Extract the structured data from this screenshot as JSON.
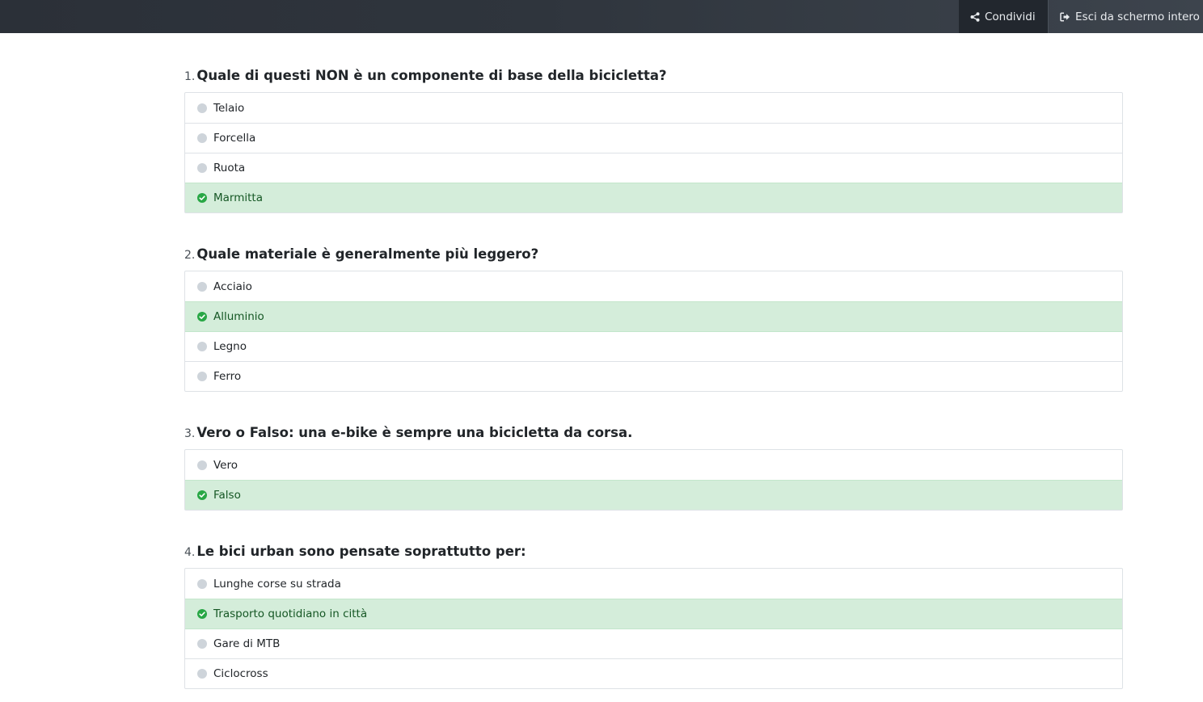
{
  "topbar": {
    "share_label": "Condividi",
    "share_icon": "share-icon",
    "exit_label": "Esci da schermo intero",
    "exit_icon": "sign-out-icon"
  },
  "colors": {
    "topbar": "#2f353d",
    "correct_bg": "#d4edda",
    "correct_text": "#155724",
    "check": "#28a745",
    "radio": "#ced4da"
  },
  "questions": [
    {
      "number": "1.",
      "text": "Quale di questi NON è un componente di base della bicicletta?",
      "options": [
        {
          "label": "Telaio",
          "correct": false
        },
        {
          "label": "Forcella",
          "correct": false
        },
        {
          "label": "Ruota",
          "correct": false
        },
        {
          "label": "Marmitta",
          "correct": true
        }
      ]
    },
    {
      "number": "2.",
      "text": "Quale materiale è generalmente più leggero?",
      "options": [
        {
          "label": "Acciaio",
          "correct": false
        },
        {
          "label": "Alluminio",
          "correct": true
        },
        {
          "label": "Legno",
          "correct": false
        },
        {
          "label": "Ferro",
          "correct": false
        }
      ]
    },
    {
      "number": "3.",
      "text": "Vero o Falso: una e-bike è sempre una bicicletta da corsa.",
      "options": [
        {
          "label": "Vero",
          "correct": false
        },
        {
          "label": "Falso",
          "correct": true
        }
      ]
    },
    {
      "number": "4.",
      "text": "Le bici urban sono pensate soprattutto per:",
      "options": [
        {
          "label": "Lunghe corse su strada",
          "correct": false
        },
        {
          "label": "Trasporto quotidiano in città",
          "correct": true
        },
        {
          "label": "Gare di MTB",
          "correct": false
        },
        {
          "label": "Ciclocross",
          "correct": false
        }
      ]
    }
  ]
}
